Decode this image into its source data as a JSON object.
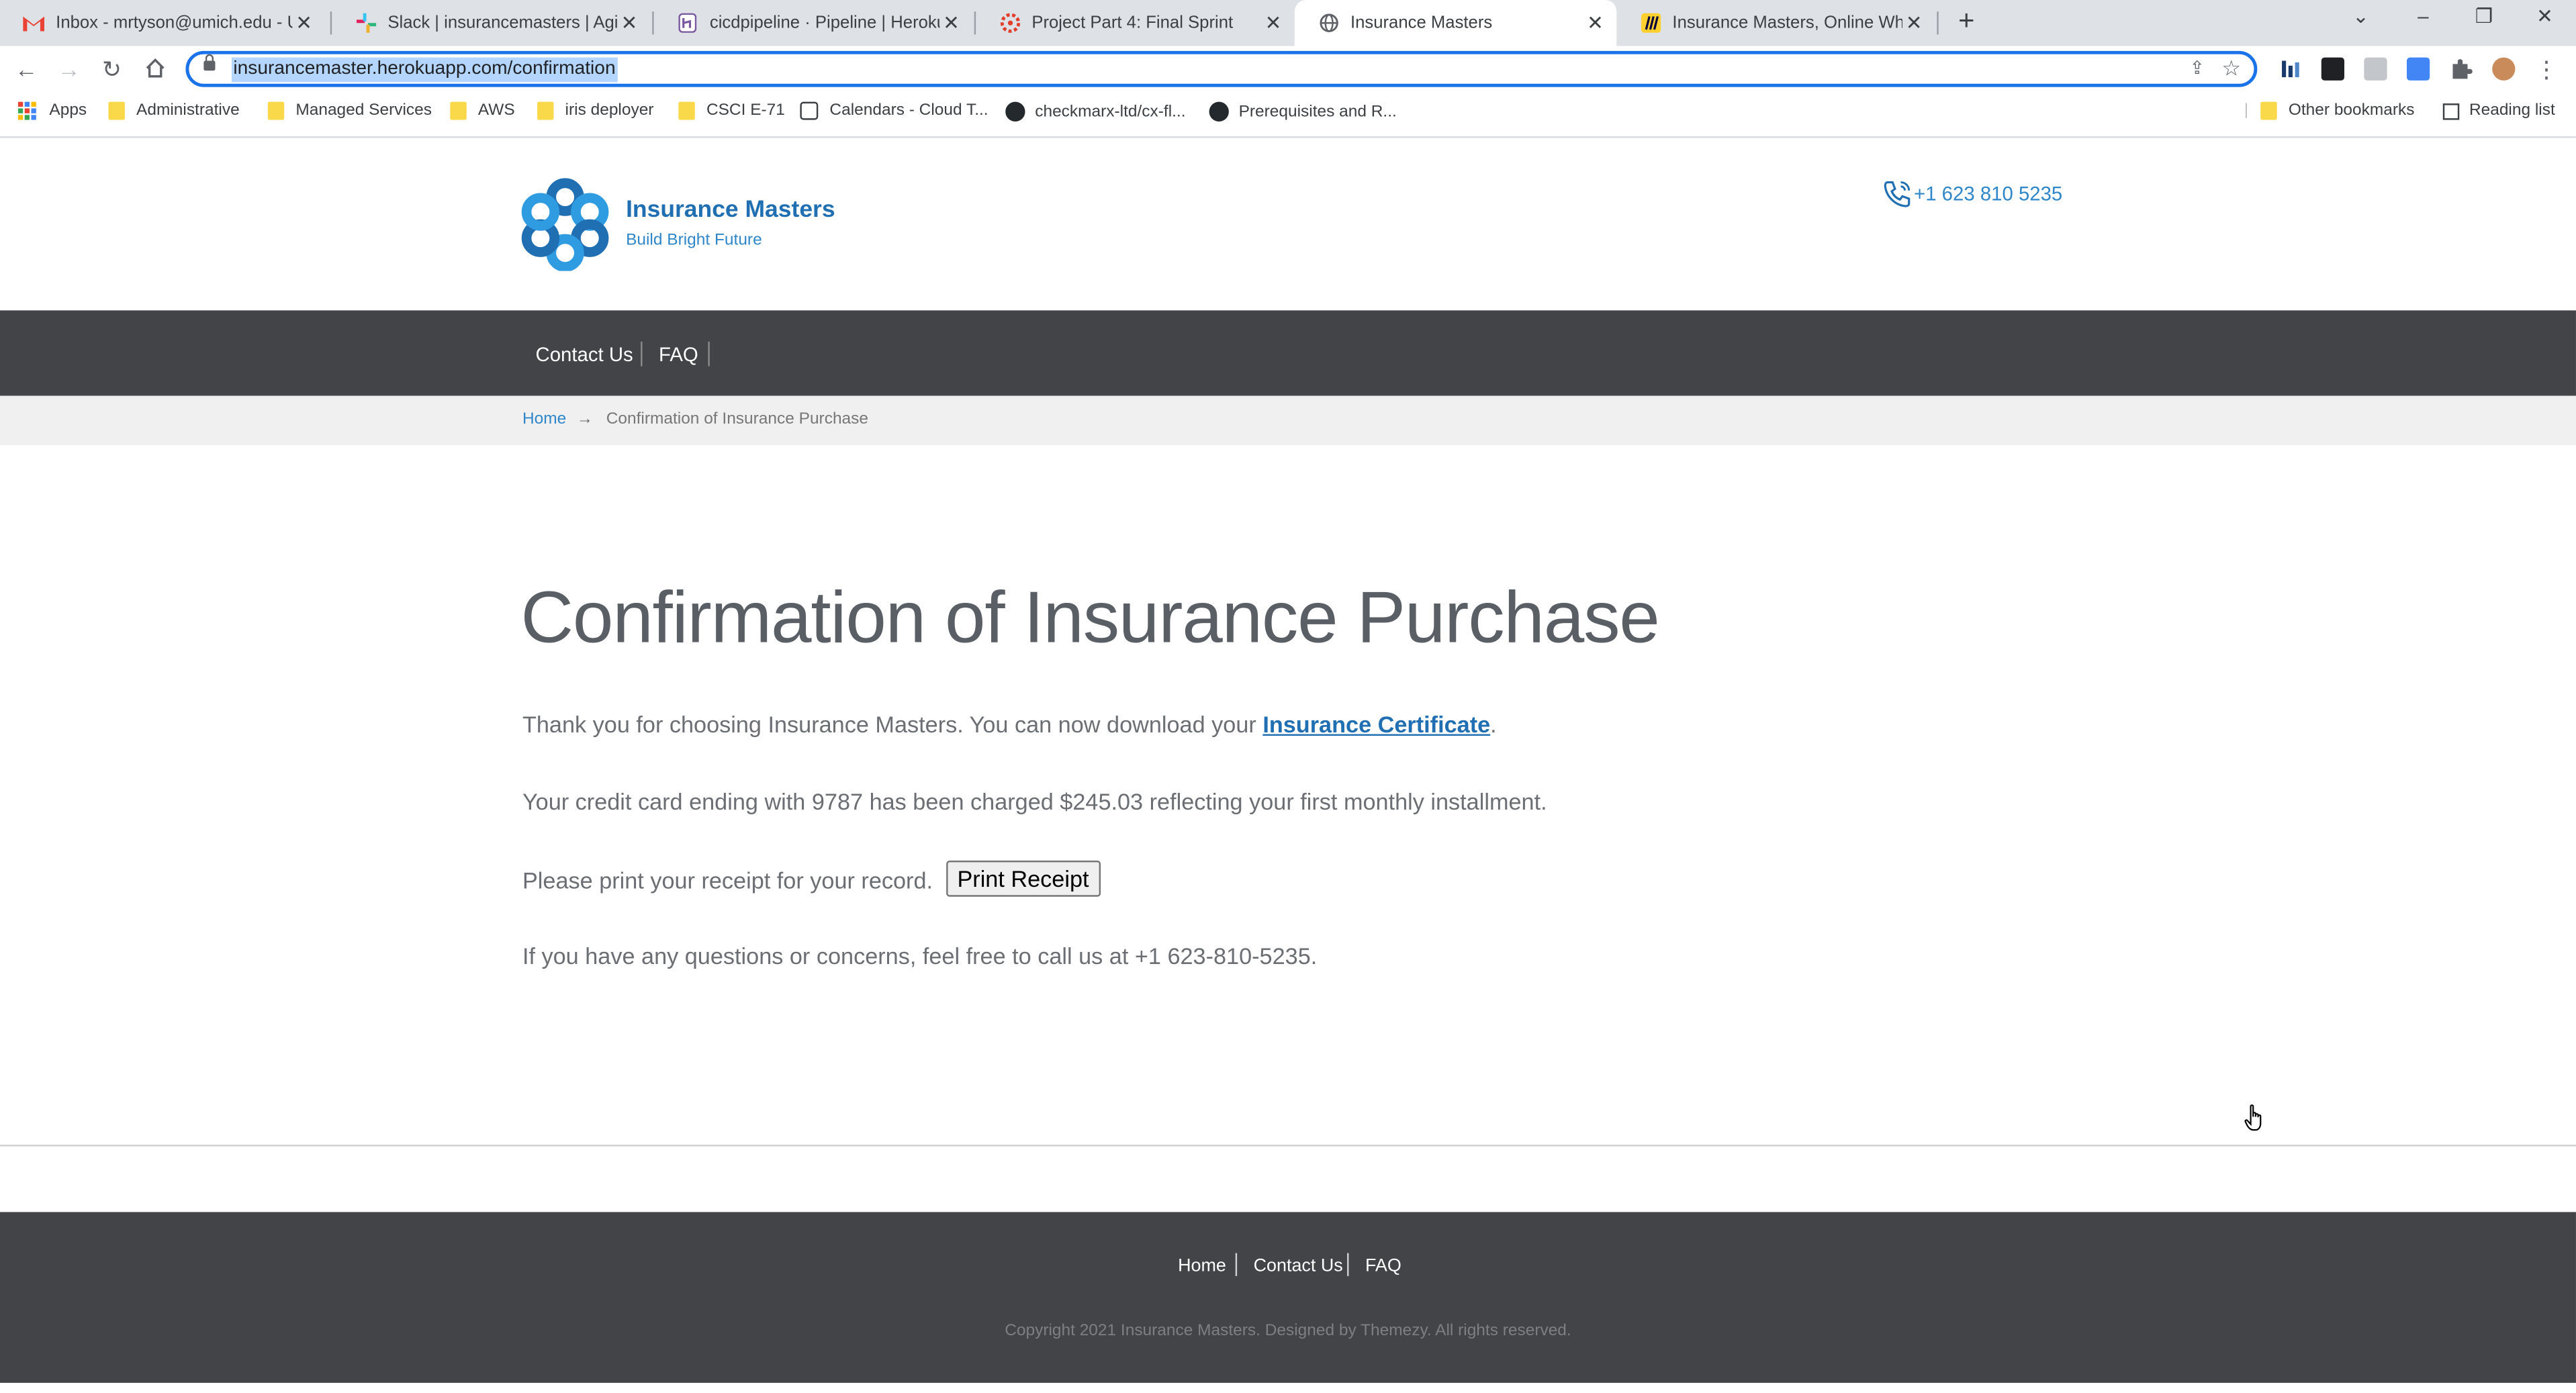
{
  "browser": {
    "tabs": [
      {
        "title": "Inbox - mrtyson@umich.edu - U",
        "icon": "gmail-icon"
      },
      {
        "title": "Slack | insurancemasters | Agile S",
        "icon": "slack-icon"
      },
      {
        "title": "cicdpipeline · Pipeline | Heroku",
        "icon": "heroku-icon"
      },
      {
        "title": "Project Part 4: Final Sprint",
        "icon": "canvas-icon"
      },
      {
        "title": "Insurance Masters",
        "icon": "globe-icon"
      },
      {
        "title": "Insurance Masters, Online White",
        "icon": "miro-icon"
      }
    ],
    "url": "insurancemaster.herokuapp.com/confirmation",
    "bookmarks": [
      "Apps",
      "Administrative",
      "Managed Services",
      "AWS",
      "iris deployer",
      "CSCI E-71",
      "Calendars - Cloud T...",
      "checkmarx-ltd/cx-fl...",
      "Prerequisites and R..."
    ],
    "other_bookmarks": "Other bookmarks",
    "reading_list": "Reading list"
  },
  "site": {
    "brand": "Insurance Masters",
    "tagline": "Build Bright Future",
    "phone": "+1 623 810 5235",
    "nav": [
      "Contact Us",
      "FAQ"
    ],
    "breadcrumb": {
      "home": "Home",
      "current": "Confirmation of Insurance Purchase"
    }
  },
  "main": {
    "title": "Confirmation of Insurance Purchase",
    "p1_prefix": "Thank you for choosing Insurance Masters. You can now download your ",
    "p1_link": "Insurance Certificate",
    "p1_suffix": ".",
    "p2": "Your credit card ending with 9787 has been charged $245.03 reflecting your first monthly installment.",
    "p3_prefix": "Please print your receipt for your record.",
    "print_button": "Print Receipt",
    "p4": "If you have any questions or concerns, feel free to call us at +1 623-810-5235."
  },
  "footer": {
    "links": [
      "Home",
      "Contact Us",
      "FAQ"
    ],
    "copyright": "Copyright 2021 Insurance Masters. Designed by Themezy. All rights reserved."
  },
  "colors": {
    "accent": "#1f6fb2",
    "nav_bg": "#434447",
    "crumb_bg": "#f0f0f0"
  }
}
